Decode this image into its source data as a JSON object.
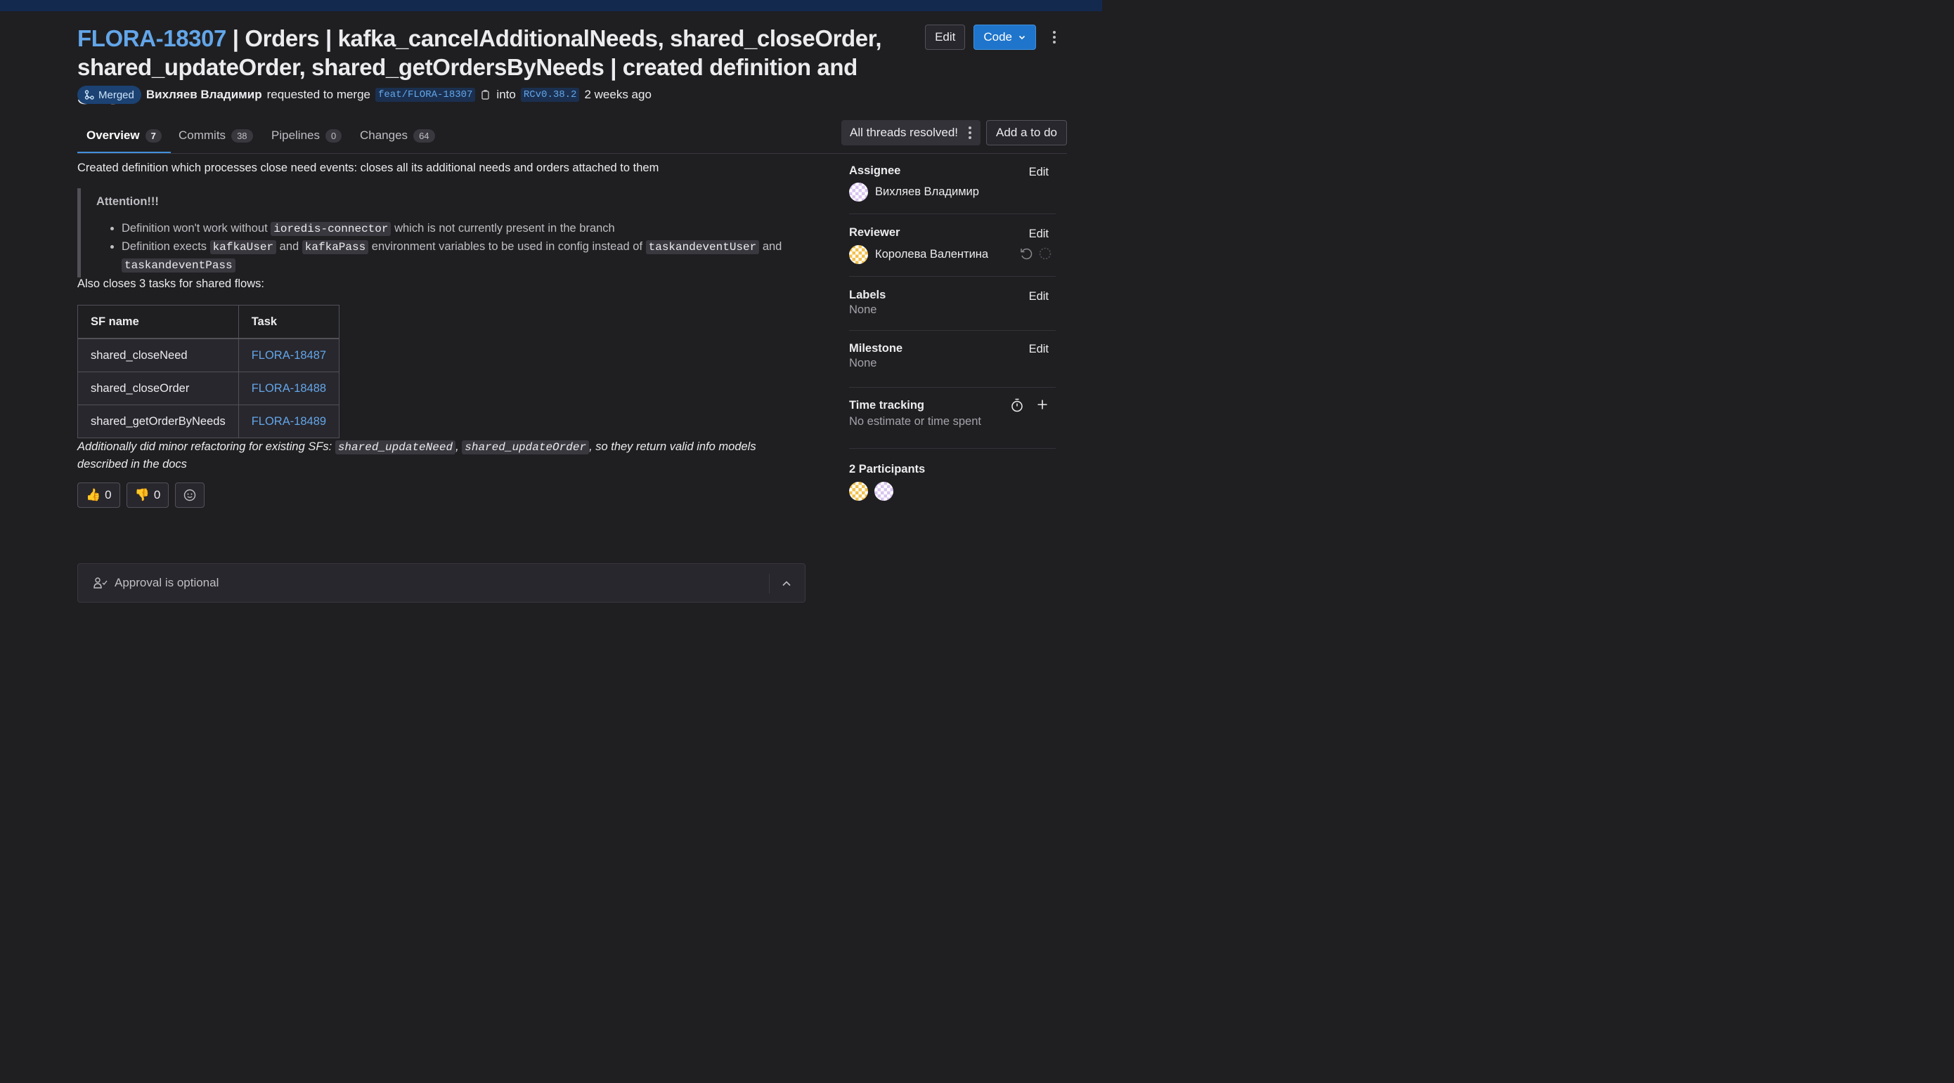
{
  "header": {
    "iid": "FLORA-18307",
    "title_rest": " | Orders | kafka_cancelAdditionalNeeds, shared_closeOrder, shared_updateOrder, shared_getOrdersByNeeds | created definition and SFs",
    "edit_label": "Edit",
    "code_label": "Code"
  },
  "meta": {
    "status": "Merged",
    "author": "Вихляев Владимир",
    "requested": "requested to merge",
    "source_branch": "feat/FLORA-18307",
    "into": "into",
    "target_branch": "RCv0.38.2",
    "time": "2 weeks ago"
  },
  "tabs": [
    {
      "label": "Overview",
      "count": "7"
    },
    {
      "label": "Commits",
      "count": "38"
    },
    {
      "label": "Pipelines",
      "count": "0"
    },
    {
      "label": "Changes",
      "count": "64"
    }
  ],
  "threads_label": "All threads resolved!",
  "todo_label": "Add a to do",
  "description": {
    "intro": "Created definition which processes close need events: closes all its additional needs and orders attached to them",
    "attention": "Attention!!!",
    "b1_a": "Definition won't work without ",
    "b1_code": "ioredis-connector",
    "b1_b": " which is not currently present in the branch",
    "b2_a": "Definition exects ",
    "b2_code1": "kafkaUser",
    "b2_and1": " and ",
    "b2_code2": "kafkaPass",
    "b2_b": " environment variables to be used in config instead of ",
    "b2_code3": "taskandeventUser",
    "b2_and2": " and ",
    "b2_code4": "taskandeventPass",
    "also": "Also closes 3 tasks for shared flows:",
    "table_headers": [
      "SF name",
      "Task"
    ],
    "table_rows": [
      [
        "shared_closeNeed",
        "FLORA-18487"
      ],
      [
        "shared_closeOrder",
        "FLORA-18488"
      ],
      [
        "shared_getOrderByNeeds",
        "FLORA-18489"
      ]
    ],
    "note_a": "Additionally did minor refactoring for existing SFs: ",
    "note_code1": "shared_updateNeed",
    "note_sep": ", ",
    "note_code2": "shared_updateOrder",
    "note_b": ", so they return valid info models described in the docs"
  },
  "reactions": {
    "thumbsup": "0",
    "thumbsdown": "0"
  },
  "approval": "Approval is optional",
  "sidebar": {
    "edit": "Edit",
    "assignee_title": "Assignee",
    "assignee": "Вихляев Владимир",
    "reviewer_title": "Reviewer",
    "reviewer": "Королева Валентина",
    "labels_title": "Labels",
    "labels_value": "None",
    "milestone_title": "Milestone",
    "milestone_value": "None",
    "time_title": "Time tracking",
    "time_value": "No estimate or time spent",
    "participants_title": "2 Participants"
  },
  "colors": {
    "background": "#1f1f22",
    "link": "#63a6e9",
    "primary": "#1f75cb",
    "topbar": "#14294e"
  }
}
